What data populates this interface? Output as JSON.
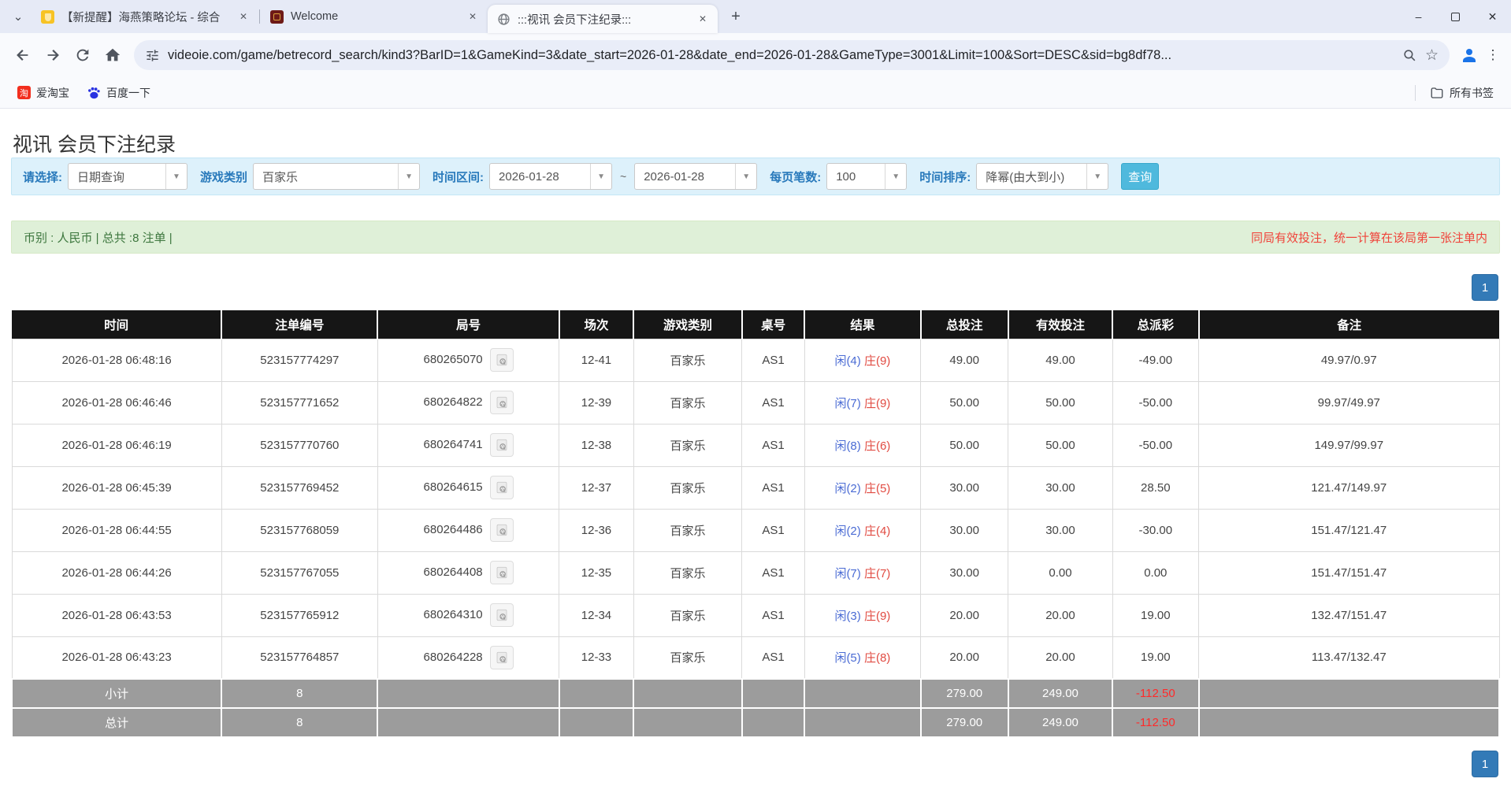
{
  "browser": {
    "tabs": [
      {
        "title": "【新提醒】海燕策略论坛 - 综合",
        "active": false
      },
      {
        "title": "Welcome",
        "active": false
      },
      {
        "title": ":::视讯 会员下注纪录:::",
        "active": true
      }
    ],
    "url": "videoie.com/game/betrecord_search/kind3?BarID=1&GameKind=3&date_start=2026-01-28&date_end=2026-01-28&GameType=3001&Limit=100&Sort=DESC&sid=bg8df78...",
    "bookmarks": {
      "taobao": "爱淘宝",
      "baidu": "百度一下",
      "all_bookmarks": "所有书签"
    }
  },
  "page": {
    "title": "视讯 会员下注纪录",
    "filter": {
      "select_label": "请选择:",
      "select_value": "日期查询",
      "game_category_label": "游戏类别",
      "game_category_value": "百家乐",
      "date_range_label": "时间区间:",
      "date_start": "2026-01-28",
      "tilde": "~",
      "date_end": "2026-01-28",
      "page_size_label": "每页笔数:",
      "page_size_value": "100",
      "sort_label": "时间排序:",
      "sort_value": "降幂(由大到小)",
      "search_button": "查询"
    },
    "info_bar": {
      "left": "币别 : 人民币 | 总共 :8 注单 |",
      "right": "同局有效投注，统一计算在该局第一张注单内"
    },
    "pagination": {
      "page": "1"
    },
    "table": {
      "headers": [
        "时间",
        "注单编号",
        "局号",
        "场次",
        "游戏类别",
        "桌号",
        "结果",
        "总投注",
        "有效投注",
        "总派彩",
        "备注"
      ],
      "rows": [
        {
          "time": "2026-01-28 06:48:16",
          "bet_id": "523157774297",
          "round_id": "680265070",
          "session": "12-41",
          "game": "百家乐",
          "table_no": "AS1",
          "result_player": "闲(4)",
          "result_banker": "庄(9)",
          "total_bet": "49.00",
          "valid_bet": "49.00",
          "payout": "-49.00",
          "remark": "49.97/0.97"
        },
        {
          "time": "2026-01-28 06:46:46",
          "bet_id": "523157771652",
          "round_id": "680264822",
          "session": "12-39",
          "game": "百家乐",
          "table_no": "AS1",
          "result_player": "闲(7)",
          "result_banker": "庄(9)",
          "total_bet": "50.00",
          "valid_bet": "50.00",
          "payout": "-50.00",
          "remark": "99.97/49.97"
        },
        {
          "time": "2026-01-28 06:46:19",
          "bet_id": "523157770760",
          "round_id": "680264741",
          "session": "12-38",
          "game": "百家乐",
          "table_no": "AS1",
          "result_player": "闲(8)",
          "result_banker": "庄(6)",
          "total_bet": "50.00",
          "valid_bet": "50.00",
          "payout": "-50.00",
          "remark": "149.97/99.97"
        },
        {
          "time": "2026-01-28 06:45:39",
          "bet_id": "523157769452",
          "round_id": "680264615",
          "session": "12-37",
          "game": "百家乐",
          "table_no": "AS1",
          "result_player": "闲(2)",
          "result_banker": "庄(5)",
          "total_bet": "30.00",
          "valid_bet": "30.00",
          "payout": "28.50",
          "remark": "121.47/149.97"
        },
        {
          "time": "2026-01-28 06:44:55",
          "bet_id": "523157768059",
          "round_id": "680264486",
          "session": "12-36",
          "game": "百家乐",
          "table_no": "AS1",
          "result_player": "闲(2)",
          "result_banker": "庄(4)",
          "total_bet": "30.00",
          "valid_bet": "30.00",
          "payout": "-30.00",
          "remark": "151.47/121.47"
        },
        {
          "time": "2026-01-28 06:44:26",
          "bet_id": "523157767055",
          "round_id": "680264408",
          "session": "12-35",
          "game": "百家乐",
          "table_no": "AS1",
          "result_player": "闲(7)",
          "result_banker": "庄(7)",
          "total_bet": "30.00",
          "valid_bet": "0.00",
          "payout": "0.00",
          "remark": "151.47/151.47"
        },
        {
          "time": "2026-01-28 06:43:53",
          "bet_id": "523157765912",
          "round_id": "680264310",
          "session": "12-34",
          "game": "百家乐",
          "table_no": "AS1",
          "result_player": "闲(3)",
          "result_banker": "庄(9)",
          "total_bet": "20.00",
          "valid_bet": "20.00",
          "payout": "19.00",
          "remark": "132.47/151.47"
        },
        {
          "time": "2026-01-28 06:43:23",
          "bet_id": "523157764857",
          "round_id": "680264228",
          "session": "12-33",
          "game": "百家乐",
          "table_no": "AS1",
          "result_player": "闲(5)",
          "result_banker": "庄(8)",
          "total_bet": "20.00",
          "valid_bet": "20.00",
          "payout": "19.00",
          "remark": "113.47/132.47"
        }
      ],
      "subtotal": {
        "label": "小计",
        "count": "8",
        "total_bet": "279.00",
        "valid_bet": "249.00",
        "payout": "-112.50"
      },
      "total": {
        "label": "总计",
        "count": "8",
        "total_bet": "279.00",
        "valid_bet": "249.00",
        "payout": "-112.50"
      }
    }
  },
  "colors": {
    "accent_blue": "#337ab7",
    "search_button_cyan": "#4fb9dd",
    "success_bg": "#dff0d8",
    "success_text": "#3c763d",
    "danger_red": "#f32525",
    "player_blue": "#4a6bd4",
    "banker_red": "#e14b42",
    "table_header_bg": "#161616",
    "summary_row_bg": "#9c9c9c"
  }
}
